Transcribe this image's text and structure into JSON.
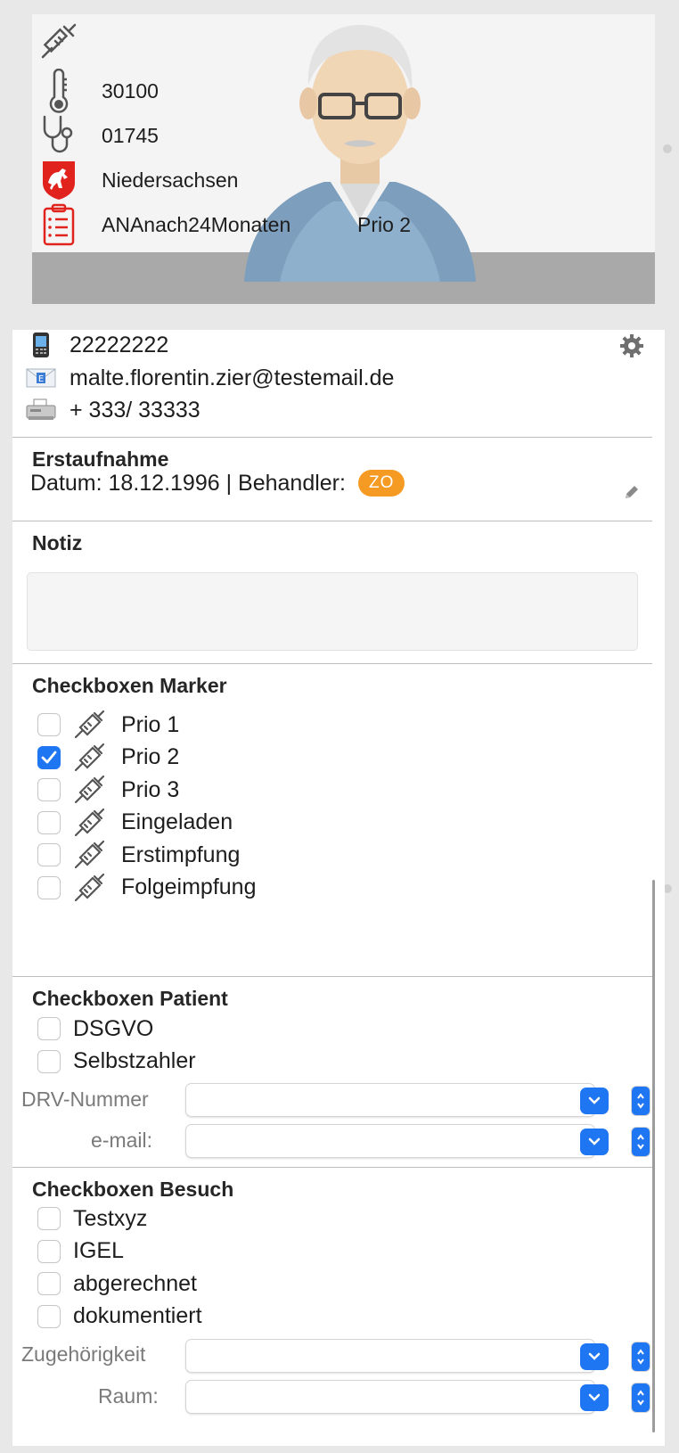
{
  "header": {
    "rows": [
      {
        "icon": "syringe-icon",
        "text": ""
      },
      {
        "icon": "thermometer-icon",
        "text": "30100"
      },
      {
        "icon": "stethoscope-icon",
        "text": "01745"
      },
      {
        "icon": "niedersachsen-crest-icon",
        "text": "Niedersachsen"
      },
      {
        "icon": "clipboard-list-icon",
        "text": "ANAnach24Monaten",
        "extra": "Prio 2"
      }
    ]
  },
  "contact": {
    "phone": "22222222",
    "email": "malte.florentin.zier@testemail.de",
    "fax": "+ 333/ 33333"
  },
  "erstaufnahme": {
    "title": "Erstaufnahme",
    "line": "Datum: 18.12.1996 | Behandler:",
    "badge": "ZO"
  },
  "notiz": {
    "title": "Notiz",
    "value": ""
  },
  "marker": {
    "title": "Checkboxen Marker",
    "items": [
      {
        "label": "Prio 1",
        "checked": false
      },
      {
        "label": "Prio 2",
        "checked": true
      },
      {
        "label": "Prio 3",
        "checked": false
      },
      {
        "label": "Eingeladen",
        "checked": false
      },
      {
        "label": "Erstimpfung",
        "checked": false
      },
      {
        "label": "Folgeimpfung",
        "checked": false
      }
    ]
  },
  "patient": {
    "title": "Checkboxen Patient",
    "items": [
      {
        "label": "DSGVO",
        "checked": false
      },
      {
        "label": "Selbstzahler",
        "checked": false
      }
    ],
    "fields": [
      {
        "label": "DRV-Nummer",
        "value": ""
      },
      {
        "label": "e-mail:",
        "value": ""
      }
    ]
  },
  "besuch": {
    "title": "Checkboxen Besuch",
    "items": [
      {
        "label": "Testxyz",
        "checked": false
      },
      {
        "label": "IGEL",
        "checked": false
      },
      {
        "label": "abgerechnet",
        "checked": false
      },
      {
        "label": "dokumentiert",
        "checked": false
      }
    ],
    "fields": [
      {
        "label": "Zugehörigkeit",
        "value": ""
      },
      {
        "label": "Raum:",
        "value": ""
      }
    ]
  },
  "colors": {
    "accent": "#1f76f3",
    "badge": "#f59a23",
    "crest": "#e0231d"
  }
}
